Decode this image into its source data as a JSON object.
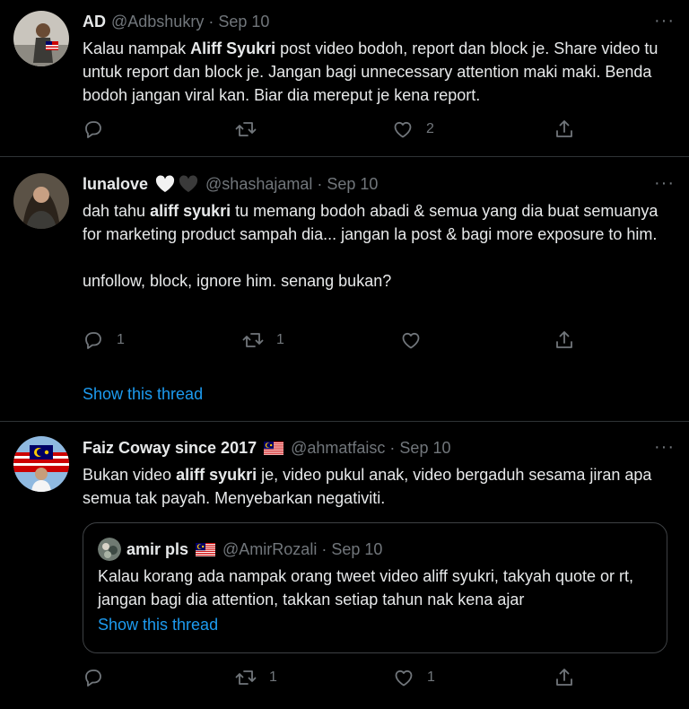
{
  "colors": {
    "background": "#000000",
    "text": "#e7e9ea",
    "muted": "#71767b",
    "link": "#1d9bf0",
    "divider": "#2f3336"
  },
  "tweets": [
    {
      "name": "AD",
      "handle": "@Adbshukry",
      "dot": "·",
      "date": "Sep 10",
      "more": "···",
      "text_before": "Kalau nampak ",
      "text_bold": "Aliff Syukri",
      "text_after": " post video bodoh, report dan block je. Share video tu untuk report dan block je. Jangan bagi unnecessary attention maki maki. Benda bodoh jangan viral kan. Biar dia mereput je kena report.",
      "replies": "",
      "retweets": "",
      "likes": "2"
    },
    {
      "name": "lunalove",
      "name_emojis": [
        "white-heart-icon",
        "black-heart-icon"
      ],
      "handle": "@shashajamal",
      "dot": "·",
      "date": "Sep 10",
      "more": "···",
      "text_before": "dah tahu ",
      "text_bold": "aliff syukri",
      "text_after": " tu memang bodoh abadi & semua yang dia buat semuanya for marketing product sampah dia... jangan la post & bagi more exposure to him.\n\nunfollow, block, ignore him. senang bukan?",
      "replies": "1",
      "retweets": "1",
      "likes": "",
      "show_thread": "Show this thread"
    },
    {
      "name": "Faiz Coway since 2017",
      "flag": "malaysia-flag-icon",
      "handle": "@ahmatfaisc",
      "dot": "·",
      "date": "Sep 10",
      "more": "···",
      "text_before": "Bukan video ",
      "text_bold": "aliff syukri",
      "text_after": " je, video pukul anak, video bergaduh sesama jiran apa semua tak payah. Menyebarkan negativiti.",
      "replies": "",
      "retweets": "1",
      "likes": "1",
      "quote": {
        "name": "amir pls",
        "flag": "malaysia-flag-icon",
        "handle": "@AmirRozali",
        "dot": "·",
        "date": "Sep 10",
        "text": "Kalau korang ada nampak orang tweet video aliff syukri, takyah quote or rt, jangan bagi dia attention, takkan setiap tahun nak kena ajar",
        "show_thread": "Show this thread"
      }
    }
  ]
}
